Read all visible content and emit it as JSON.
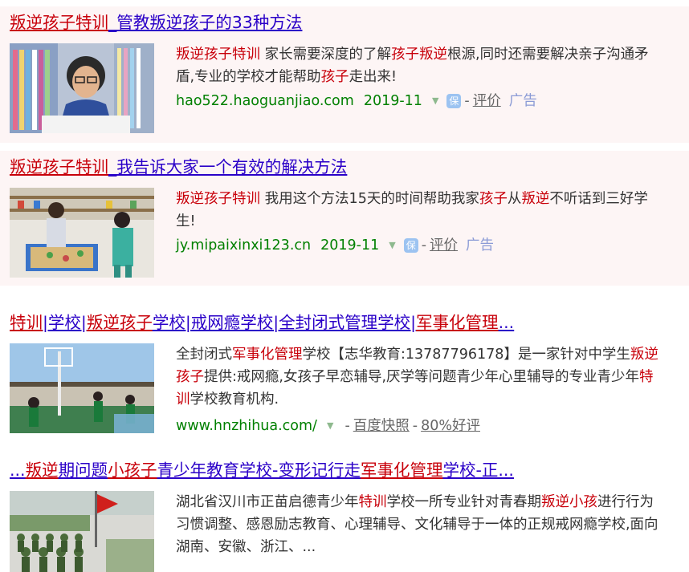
{
  "results": [
    {
      "title_parts": [
        {
          "text": "叛逆孩子特训",
          "hl": true
        },
        {
          "text": "_管教叛逆孩子的33种方法",
          "hl": false
        }
      ],
      "desc_parts": [
        {
          "text": "叛逆孩子特训",
          "hl": true
        },
        {
          "text": " 家长需要深度的了解",
          "hl": false
        },
        {
          "text": "孩子叛逆",
          "hl": true
        },
        {
          "text": "根源,同时还需要解决亲子沟通矛盾,专业的学校才能帮助",
          "hl": false
        },
        {
          "text": "孩子",
          "hl": true
        },
        {
          "text": "走出来!",
          "hl": false
        }
      ],
      "url": "hao522.haoguanjiao.com",
      "date": "2019-11",
      "bao_icon": "保",
      "evaluate": "评价",
      "ad": "广告"
    },
    {
      "title_parts": [
        {
          "text": "叛逆孩子特训",
          "hl": true
        },
        {
          "text": "_我告诉大家一个有效的解决方法",
          "hl": false
        }
      ],
      "desc_parts": [
        {
          "text": "叛逆孩子特训",
          "hl": true
        },
        {
          "text": " 我用这个方法15天的时间帮助我家",
          "hl": false
        },
        {
          "text": "孩子",
          "hl": true
        },
        {
          "text": "从",
          "hl": false
        },
        {
          "text": "叛逆",
          "hl": true
        },
        {
          "text": "不听话到三好学生!",
          "hl": false
        }
      ],
      "url": "jy.mipaixinxi123.cn",
      "date": "2019-11",
      "bao_icon": "保",
      "evaluate": "评价",
      "ad": "广告"
    },
    {
      "title_parts": [
        {
          "text": "特训",
          "hl": true
        },
        {
          "text": "|学校|",
          "hl": false
        },
        {
          "text": "叛逆孩子",
          "hl": true
        },
        {
          "text": "学校|戒网瘾学校|全封闭式管理学校|",
          "hl": false
        },
        {
          "text": "军事化管理",
          "hl": true
        },
        {
          "text": "...",
          "hl": false
        }
      ],
      "desc_parts": [
        {
          "text": "全封闭式",
          "hl": false
        },
        {
          "text": "军事化管理",
          "hl": true
        },
        {
          "text": "学校【志华教育:13787796178】是一家针对中学生",
          "hl": false
        },
        {
          "text": "叛逆孩子",
          "hl": true
        },
        {
          "text": "提供:戒网瘾,女孩子早恋辅导,厌学等问题青少年心里辅导的专业青少年",
          "hl": false
        },
        {
          "text": "特训",
          "hl": true
        },
        {
          "text": "学校教育机构.",
          "hl": false
        }
      ],
      "url": "www.hnzhihua.com/",
      "snapshot": "百度快照",
      "rating": "80%好评"
    },
    {
      "title_parts": [
        {
          "text": "...",
          "hl": false
        },
        {
          "text": "叛逆",
          "hl": true
        },
        {
          "text": "期问题",
          "hl": false
        },
        {
          "text": "小孩子",
          "hl": true
        },
        {
          "text": "青少年教育学校-变形记行走",
          "hl": false
        },
        {
          "text": "军事化管理",
          "hl": true
        },
        {
          "text": "学校-正...",
          "hl": false
        }
      ],
      "desc_parts": [
        {
          "text": "湖北省汉川市正苗启德青少年",
          "hl": false
        },
        {
          "text": "特训",
          "hl": true
        },
        {
          "text": "学校一所专业针对青春期",
          "hl": false
        },
        {
          "text": "叛逆小孩",
          "hl": true
        },
        {
          "text": "进行行为习惯调整、感恩励志教育、心理辅导、文化辅导于一体的正规戒网瘾学校,面向湖南、安徽、浙江、...",
          "hl": false
        }
      ]
    }
  ],
  "icons": {
    "dropdown": "chevron-down-icon",
    "bao": "bao-shield-icon"
  }
}
